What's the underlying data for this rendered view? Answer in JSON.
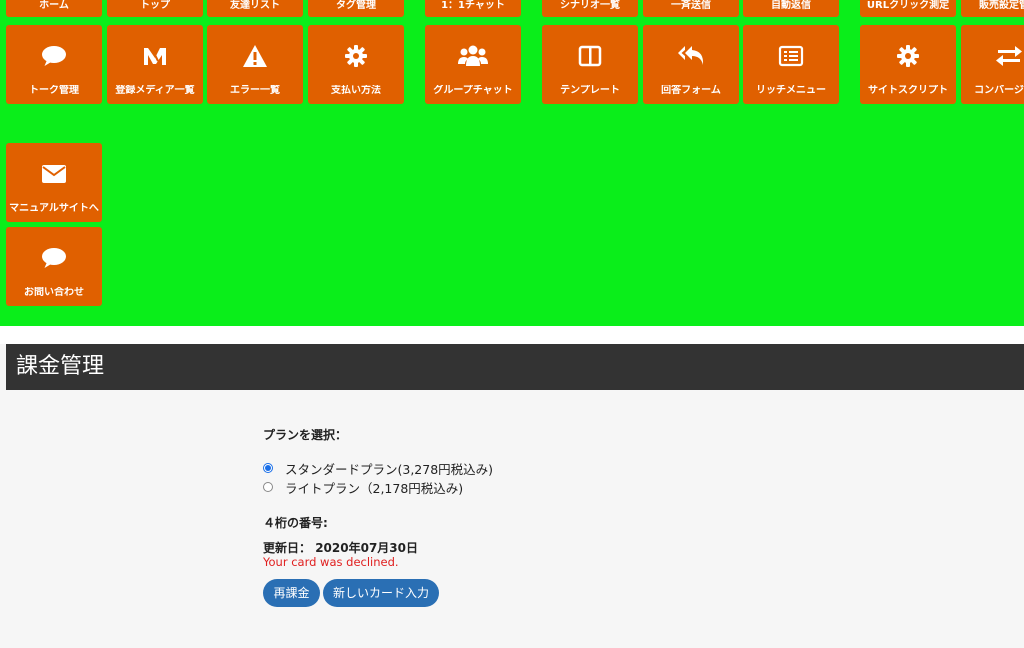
{
  "nav": {
    "row0": [
      "ホーム",
      "トップ",
      "友達リスト",
      "タグ管理",
      "1：1チャット",
      "シナリオ一覧",
      "一斉送信",
      "自動返信",
      "URLクリック測定",
      "販売設定管理"
    ],
    "row1": [
      "トーク管理",
      "登録メディア一覧",
      "エラー一覧",
      "支払い方法",
      "グループチャット",
      "テンプレート",
      "回答フォーム",
      "リッチメニュー",
      "サイトスクリプト",
      "コンバージョン"
    ],
    "row2": [
      "マニュアルサイトへ"
    ],
    "row3": [
      "お問い合わせ"
    ]
  },
  "colors": {
    "nav_bg": "#0aee1a",
    "tile_bg": "#e06000",
    "title_bg": "#333333",
    "button_bg": "#2a6fb4",
    "error": "#e02020"
  },
  "page": {
    "title": "課金管理"
  },
  "plan": {
    "label": "プランを選択：",
    "options": [
      {
        "label": "スタンダードプラン(3,278円税込み)",
        "selected": true
      },
      {
        "label": "ライトプラン（2,178円税込み)",
        "selected": false
      }
    ]
  },
  "card": {
    "digits_label": "４桁の番号:",
    "renewal_label": "更新日：",
    "renewal_date": "2020年07月30日",
    "error": "Your card was declined."
  },
  "buttons": {
    "recharge": "再課金",
    "new_card": "新しいカード入力"
  }
}
